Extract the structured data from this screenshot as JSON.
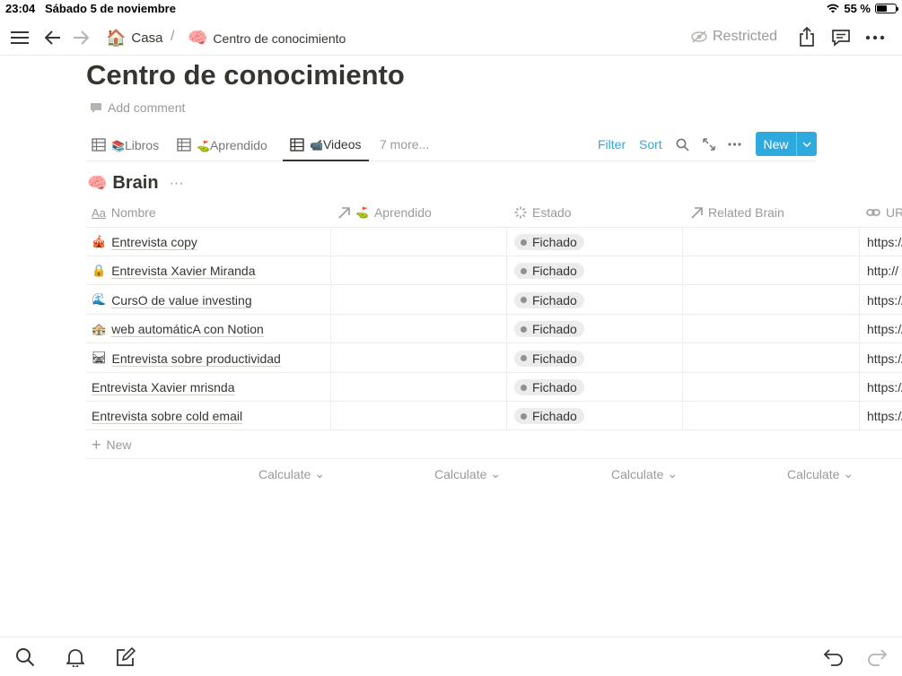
{
  "status_bar": {
    "time": "23:04",
    "date": "Sábado 5 de noviembre",
    "battery": "55 %",
    "battery_level": 0.55
  },
  "nav": {
    "breadcrumb_home_emoji": "🏠",
    "breadcrumb_home": "Casa",
    "separator": "/",
    "breadcrumb_page_emoji": "🧠",
    "breadcrumb_page": "Centro de conocimiento",
    "restricted": "Restricted"
  },
  "page": {
    "title": "Centro de conocimiento",
    "add_comment": "Add comment"
  },
  "views": {
    "tabs": [
      {
        "emoji": "📚",
        "label": "Libros"
      },
      {
        "emoji": "⛳",
        "label": "Aprendido"
      },
      {
        "emoji": "📹",
        "label": "Videos"
      }
    ],
    "more": "7 more...",
    "filter": "Filter",
    "sort": "Sort",
    "new": "New"
  },
  "database": {
    "emoji": "🧠",
    "title": "Brain",
    "columns": {
      "name": "Nombre",
      "name_icon": "Aa",
      "aprendido_emoji": "⛳",
      "aprendido": "Aprendido",
      "estado": "Estado",
      "related": "Related Brain",
      "url": "URL"
    },
    "rows": [
      {
        "emoji": "🎪",
        "name": "Entrevista copy",
        "estado": "Fichado",
        "url": "https://"
      },
      {
        "emoji": "🔒",
        "name": "Entrevista Xavier Miranda",
        "estado": "Fichado",
        "url": "http://"
      },
      {
        "emoji": "🌊",
        "name": "CursO de value investing",
        "estado": "Fichado",
        "url": "https://"
      },
      {
        "emoji": "🏤",
        "name": "web automáticA con Notion",
        "estado": "Fichado",
        "url": "https://"
      },
      {
        "emoji": "🛤",
        "name": "Entrevista sobre productividad",
        "estado": "Fichado",
        "url": "https://"
      },
      {
        "emoji": "",
        "name": "Entrevista Xavier mrisnda",
        "estado": "Fichado",
        "url": "https://"
      },
      {
        "emoji": "",
        "name": "Entrevista sobre cold email",
        "estado": "Fichado",
        "url": "https://"
      }
    ],
    "new_row": "New",
    "calculate": "Calculate"
  },
  "colors": {
    "accent": "#2eaadc",
    "text": "#37352f",
    "muted": "#9b9a97",
    "border": "#ededec"
  }
}
